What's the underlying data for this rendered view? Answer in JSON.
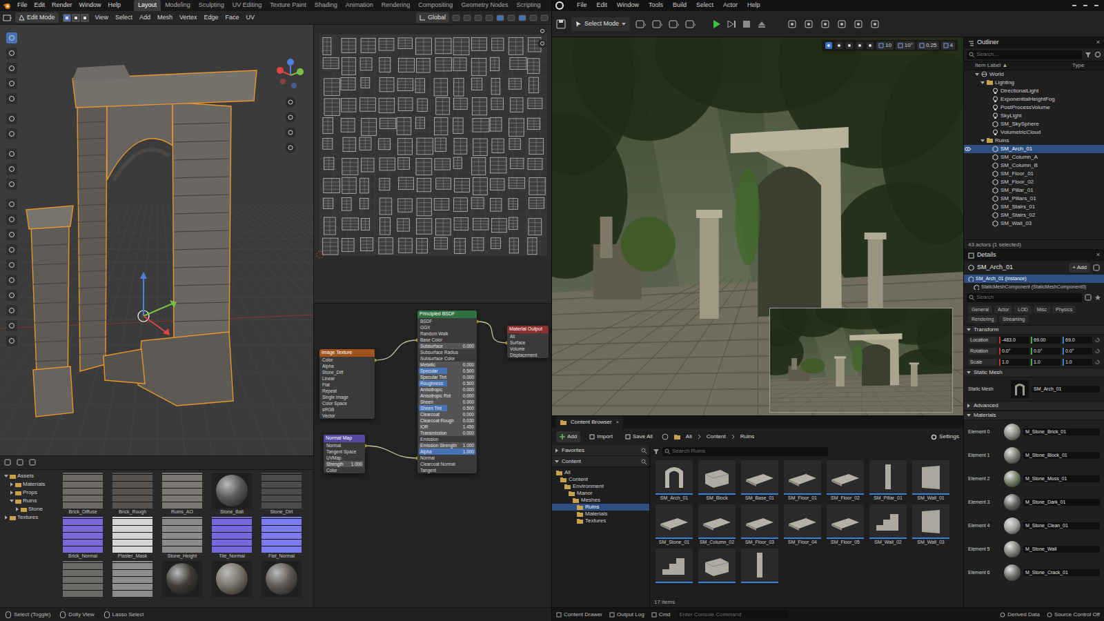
{
  "blender": {
    "menu": [
      "File",
      "Edit",
      "Render",
      "Window",
      "Help"
    ],
    "workspaces": [
      {
        "label": "Layout",
        "selected": true
      },
      {
        "label": "Modeling",
        "selected": false
      },
      {
        "label": "Sculpting",
        "selected": false
      },
      {
        "label": "UV Editing",
        "selected": false
      },
      {
        "label": "Texture Paint",
        "selected": false
      },
      {
        "label": "Shading",
        "selected": false
      },
      {
        "label": "Animation",
        "selected": false
      },
      {
        "label": "Rendering",
        "selected": false
      },
      {
        "label": "Compositing",
        "selected": false
      },
      {
        "label": "Geometry Nodes",
        "selected": false
      },
      {
        "label": "Scripting",
        "selected": false
      }
    ],
    "header": {
      "mode": "Edit Mode",
      "menus": [
        "View",
        "Select",
        "Add",
        "Mesh",
        "Vertex",
        "Edge",
        "Face",
        "UV"
      ],
      "orientation": "Global"
    },
    "nodes": [
      {
        "title": "Image Texture",
        "color": "#a0531d",
        "rows": [
          {
            "label": "Color"
          },
          {
            "label": "Alpha"
          },
          {
            "label": "Stone_Diff"
          },
          {
            "label": "Linear"
          },
          {
            "label": "Flat"
          },
          {
            "label": "Repeat"
          },
          {
            "label": "Single Image"
          },
          {
            "label": "Color Space"
          },
          {
            "label": "sRGB"
          },
          {
            "label": "Vector"
          }
        ]
      },
      {
        "title": "Principled BSDF",
        "color": "#2f7040",
        "rows": [
          {
            "label": "BSDF"
          },
          {
            "label": "GGX"
          },
          {
            "label": "Random Walk"
          },
          {
            "label": "Base Color"
          },
          {
            "label": "Subsurface",
            "value": "0.000"
          },
          {
            "label": "Subsurface Radius"
          },
          {
            "label": "Subsurface Color"
          },
          {
            "label": "Metallic",
            "value": "0.000"
          },
          {
            "label": "Specular",
            "value": "0.500",
            "level": 0.5
          },
          {
            "label": "Specular Tint",
            "value": "0.000"
          },
          {
            "label": "Roughness",
            "value": "0.500",
            "level": 0.5
          },
          {
            "label": "Anisotropic",
            "value": "0.000"
          },
          {
            "label": "Anisotropic Rot",
            "value": "0.000"
          },
          {
            "label": "Sheen",
            "value": "0.000"
          },
          {
            "label": "Sheen Tint",
            "value": "0.500",
            "level": 0.5
          },
          {
            "label": "Clearcoat",
            "value": "0.000"
          },
          {
            "label": "Clearcoat Rough",
            "value": "0.030"
          },
          {
            "label": "IOR",
            "value": "1.450"
          },
          {
            "label": "Transmission",
            "value": "0.000"
          },
          {
            "label": "Emission"
          },
          {
            "label": "Emission Strength",
            "value": "1.000"
          },
          {
            "label": "Alpha",
            "value": "1.000",
            "level": 1.0
          },
          {
            "label": "Normal"
          },
          {
            "label": "Clearcoat Normal"
          },
          {
            "label": "Tangent"
          }
        ]
      },
      {
        "title": "Normal Map",
        "color": "#5548a0",
        "rows": [
          {
            "label": "Normal"
          },
          {
            "label": "Tangent Space"
          },
          {
            "label": "UVMap"
          },
          {
            "label": "Strength",
            "value": "1.000"
          },
          {
            "label": "Color"
          }
        ]
      },
      {
        "title": "Material Output",
        "color": "#8c2f2f",
        "rows": [
          {
            "label": "All"
          },
          {
            "label": "Surface"
          },
          {
            "label": "Volume"
          },
          {
            "label": "Displacement"
          }
        ]
      }
    ],
    "links": [
      {
        "from": 0,
        "from_row": 0,
        "to": 1,
        "to_row": 3
      },
      {
        "from": 2,
        "from_row": 0,
        "to": 1,
        "to_row": 22
      },
      {
        "from": 1,
        "from_row": 0,
        "to": 3,
        "to_row": 1
      }
    ],
    "asset_tree": [
      {
        "label": "Assets",
        "depth": 0,
        "expanded": true
      },
      {
        "label": "Materials",
        "depth": 1,
        "expanded": false
      },
      {
        "label": "Props",
        "depth": 1,
        "expanded": false
      },
      {
        "label": "Ruins",
        "depth": 1,
        "expanded": true
      },
      {
        "label": "Stone",
        "depth": 2,
        "expanded": false
      },
      {
        "label": "Textures",
        "depth": 0,
        "expanded": false
      }
    ],
    "thumbnails": [
      {
        "label": "Brick_Diffuse",
        "kind": "flat",
        "color": "#6d6a66"
      },
      {
        "label": "Brick_Rough",
        "kind": "flat",
        "color": "#55524f"
      },
      {
        "label": "Ruins_AO",
        "kind": "flat",
        "color": "#7b7874"
      },
      {
        "label": "Stone_Ball",
        "kind": "sphere",
        "color": "#5a5a5a"
      },
      {
        "label": "Stone_Dirt",
        "kind": "flat",
        "color": "#4c4b49"
      },
      {
        "label": "Brick_Normal",
        "kind": "flat",
        "color": "#7a6ad8"
      },
      {
        "label": "Plaster_Mask",
        "kind": "flat",
        "color": "#d4d4d4"
      },
      {
        "label": "Stone_Height",
        "kind": "flat",
        "color": "#8a8a8a"
      },
      {
        "label": "Tile_Normal",
        "kind": "flat",
        "color": "#7669de"
      },
      {
        "label": "Flat_Normal",
        "kind": "flat",
        "color": "#7c7cf2"
      },
      {
        "kind": "flat",
        "color": "#6c6a67"
      },
      {
        "kind": "flat",
        "color": "#8e8d8b"
      },
      {
        "kind": "sphere",
        "color": "#3e3b36"
      },
      {
        "kind": "sphere",
        "color": "#7a746a"
      },
      {
        "kind": "sphere",
        "color": "#5e5a55"
      }
    ],
    "status_bar": [
      "Select (Toggle)",
      "Dolly View",
      "Lasso Select"
    ]
  },
  "unreal": {
    "menu": [
      "File",
      "Edit",
      "Window",
      "Tools",
      "Build",
      "Select",
      "Actor",
      "Help"
    ],
    "toolbar": {
      "mode": "Select Mode"
    },
    "viewport_toolbar": [
      "10",
      "10°",
      "0.25",
      "4"
    ],
    "outliner": {
      "title": "Outliner",
      "close": "×",
      "search": "Search...",
      "columns": [
        "Item Label ▲",
        "Type"
      ],
      "items": [
        {
          "label": "World",
          "kind": "world",
          "depth": 0,
          "expanded": true,
          "selected": false
        },
        {
          "label": "Lighting",
          "kind": "folder",
          "depth": 1,
          "expanded": true,
          "selected": false
        },
        {
          "label": "DirectionalLight",
          "kind": "light",
          "depth": 2,
          "expanded": false,
          "selected": false
        },
        {
          "label": "ExponentialHeightFog",
          "kind": "light",
          "depth": 2,
          "expanded": false,
          "selected": false
        },
        {
          "label": "PostProcessVolume",
          "kind": "light",
          "depth": 2,
          "expanded": false,
          "selected": false
        },
        {
          "label": "SkyLight",
          "kind": "light",
          "depth": 2,
          "expanded": false,
          "selected": false
        },
        {
          "label": "SM_SkySphere",
          "kind": "mesh",
          "depth": 2,
          "expanded": false,
          "selected": false
        },
        {
          "label": "VolumetricCloud",
          "kind": "light",
          "depth": 2,
          "expanded": false,
          "selected": false
        },
        {
          "label": "Ruins",
          "kind": "folder",
          "depth": 1,
          "expanded": true,
          "selected": false
        },
        {
          "label": "SM_Arch_01",
          "kind": "mesh",
          "depth": 2,
          "expanded": false,
          "selected": true
        },
        {
          "label": "SM_Column_A",
          "kind": "mesh",
          "depth": 2,
          "expanded": false,
          "selected": false
        },
        {
          "label": "SM_Column_B",
          "kind": "mesh",
          "depth": 2,
          "expanded": false,
          "selected": false
        },
        {
          "label": "SM_Floor_01",
          "kind": "mesh",
          "depth": 2,
          "expanded": false,
          "selected": false
        },
        {
          "label": "SM_Floor_02",
          "kind": "mesh",
          "depth": 2,
          "expanded": false,
          "selected": false
        },
        {
          "label": "SM_Pillar_01",
          "kind": "mesh",
          "depth": 2,
          "expanded": false,
          "selected": false
        },
        {
          "label": "SM_Pillars_01",
          "kind": "mesh",
          "depth": 2,
          "expanded": false,
          "selected": false
        },
        {
          "label": "SM_Stairs_01",
          "kind": "mesh",
          "depth": 2,
          "expanded": false,
          "selected": false
        },
        {
          "label": "SM_Stairs_02",
          "kind": "mesh",
          "depth": 2,
          "expanded": false,
          "selected": false
        },
        {
          "label": "SM_Wall_03",
          "kind": "mesh",
          "depth": 2,
          "expanded": false,
          "selected": false
        }
      ],
      "footer": "43 actors (1 selected)"
    },
    "details": {
      "title": "Details",
      "close": "×",
      "actor": "SM_Arch_01",
      "add": "+ Add",
      "components": [
        {
          "label": "SM_Arch_01 (Instance)",
          "selected": true
        },
        {
          "label": "StaticMeshComponent (StaticMeshComponent0)",
          "selected": false
        }
      ],
      "search": "Search",
      "filters": [
        "General",
        "Actor",
        "LOD",
        "Misc",
        "Physics",
        "Rendering",
        "Streaming"
      ],
      "transform": {
        "title": "Transform",
        "rows": [
          {
            "label": "Location",
            "values": [
              "-483.0",
              "69.00",
              "69.0"
            ]
          },
          {
            "label": "Rotation",
            "values": [
              "0.0°",
              "0.0°",
              "0.0°"
            ]
          },
          {
            "label": "Scale",
            "values": [
              "1.0",
              "1.0",
              "1.0"
            ]
          }
        ]
      },
      "static_mesh": {
        "title": "Static Mesh",
        "label": "Static Mesh",
        "value": "SM_Arch_01"
      },
      "collapsed": "Advanced",
      "materials": {
        "title": "Materials",
        "elements": [
          {
            "label": "Element 0",
            "material": "M_Stone_Brick_01",
            "color": "#8a8a84"
          },
          {
            "label": "Element 1",
            "material": "M_Stone_Block_01",
            "color": "#76786e"
          },
          {
            "label": "Element 2",
            "material": "M_Stone_Moss_01",
            "color": "#6f7a5e"
          },
          {
            "label": "Element 3",
            "material": "M_Stone_Dark_01",
            "color": "#5f605c"
          },
          {
            "label": "Element 4",
            "material": "M_Stone_Clean_01",
            "color": "#9c9c98"
          },
          {
            "label": "Element 5",
            "material": "M_Stone_Wall",
            "color": "#7e7f78"
          },
          {
            "label": "Element 6",
            "material": "M_Stone_Crack_01",
            "color": "#6a6b66"
          }
        ]
      }
    },
    "content_browser": {
      "tab": "Content Browser",
      "close": "×",
      "buttons": [
        "Add",
        "Import",
        "Save All"
      ],
      "path": [
        "All",
        "Content",
        "Ruins"
      ],
      "settings": "Settings",
      "sections": [
        "Favorites",
        "Content"
      ],
      "tree": [
        {
          "label": "All",
          "depth": 0,
          "selected": false
        },
        {
          "label": "Content",
          "depth": 1,
          "selected": false
        },
        {
          "label": "Environment",
          "depth": 2,
          "selected": false
        },
        {
          "label": "Manor",
          "depth": 3,
          "selected": false
        },
        {
          "label": "Meshes",
          "depth": 4,
          "selected": false
        },
        {
          "label": "Ruins",
          "depth": 5,
          "selected": true
        },
        {
          "label": "Materials",
          "depth": 5,
          "selected": false
        },
        {
          "label": "Textures",
          "depth": 5,
          "selected": false
        }
      ],
      "search": "Search Ruins",
      "assets": [
        {
          "label": "SM_Arch_01",
          "kind": "arch"
        },
        {
          "label": "SM_Block",
          "kind": "block"
        },
        {
          "label": "SM_Base_01",
          "kind": "slab"
        },
        {
          "label": "SM_Floor_01",
          "kind": "slab"
        },
        {
          "label": "SM_Floor_02",
          "kind": "slab"
        },
        {
          "label": "SM_Pillar_01",
          "kind": "pillar"
        },
        {
          "label": "SM_Wall_01",
          "kind": "wall"
        },
        {
          "label": "SM_Stone_01",
          "kind": "slab"
        },
        {
          "label": "SM_Column_02",
          "kind": "slab"
        },
        {
          "label": "SM_Floor_03",
          "kind": "slab"
        },
        {
          "label": "SM_Floor_04",
          "kind": "slab"
        },
        {
          "label": "SM_Floor_05",
          "kind": "slab"
        },
        {
          "label": "SM_Wall_02",
          "kind": "stairs"
        },
        {
          "label": "SM_Wall_03",
          "kind": "wall"
        },
        {
          "kind": "stairs"
        },
        {
          "kind": "block"
        },
        {
          "kind": "pillar"
        }
      ],
      "count": "17 items"
    },
    "status_bar": {
      "items": [
        "Content Drawer",
        "Output Log",
        "Cmd"
      ],
      "console": "Enter Console Command",
      "right": [
        "Derived Data",
        "Source Control Off"
      ]
    }
  }
}
